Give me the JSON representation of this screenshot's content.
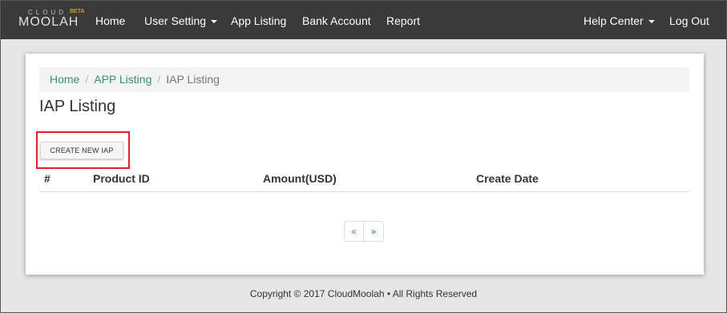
{
  "logo": {
    "top_text": "CLOUD",
    "main_text": "MOOLAH",
    "badge": "BETA"
  },
  "nav": {
    "home": "Home",
    "user_setting": "User Setting",
    "app_listing": "App Listing",
    "bank_account": "Bank Account",
    "report": "Report",
    "help_center": "Help Center",
    "logout": "Log Out"
  },
  "breadcrumb": [
    "Home",
    "APP Listing",
    "IAP Listing"
  ],
  "page_title": "IAP Listing",
  "create_button": "CREATE NEW IAP",
  "table": {
    "columns": [
      "#",
      "Product ID",
      "Amount(USD)",
      "Create Date"
    ],
    "rows": []
  },
  "pagination": {
    "prev": "«",
    "next": "»"
  },
  "footer": "Copyright © 2017  CloudMoolah • All Rights Reserved",
  "colors": {
    "navbar": "#3a3a3a",
    "link": "#3a8c82",
    "highlight": "#e0202a"
  }
}
